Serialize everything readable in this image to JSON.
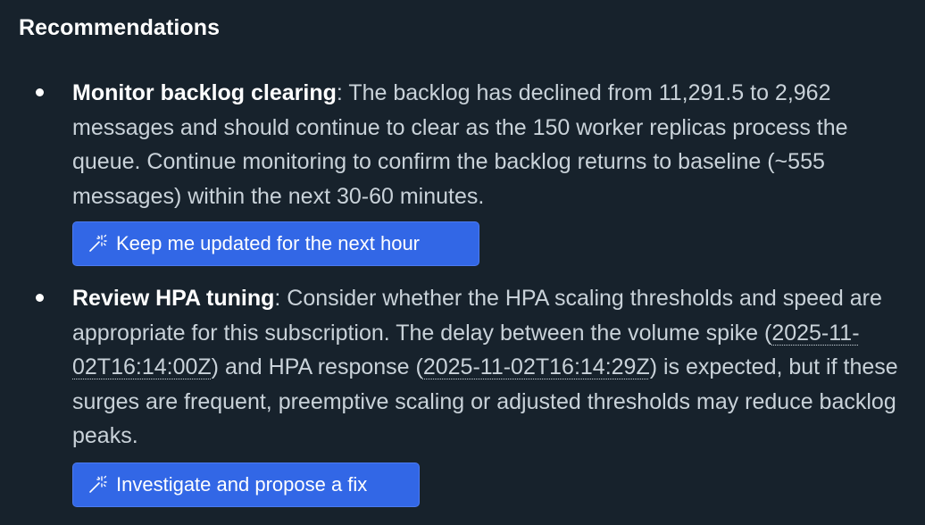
{
  "section": {
    "heading": "Recommendations"
  },
  "recommendations": [
    {
      "title": "Monitor backlog clearing",
      "body": ": The backlog has declined from 11,291.5 to 2,962 messages and should continue to clear as the 150 worker replicas process the queue. Continue monitoring to confirm the backlog returns to baseline (~555 messages) within the next 30-60 minutes.",
      "action_label": "Keep me updated for the next hour",
      "action_icon": "magic-wand-icon"
    },
    {
      "title": "Review HPA tuning",
      "body_part1": ": Consider whether the HPA scaling thresholds and speed are appropriate for this subscription. The delay between the volume spike (",
      "timestamp1": "2025-11-02T16:14:00Z",
      "body_part2": ") and HPA response (",
      "timestamp2": "2025-11-02T16:14:29Z",
      "body_part3": ") is expected, but if these surges are frequent, preemptive scaling or adjusted thresholds may reduce backlog peaks.",
      "action_label": "Investigate and propose a fix",
      "action_icon": "magic-wand-icon"
    }
  ],
  "colors": {
    "background": "#17222c",
    "text": "#c9d2d9",
    "heading": "#ffffff",
    "button": "#3267e6"
  }
}
